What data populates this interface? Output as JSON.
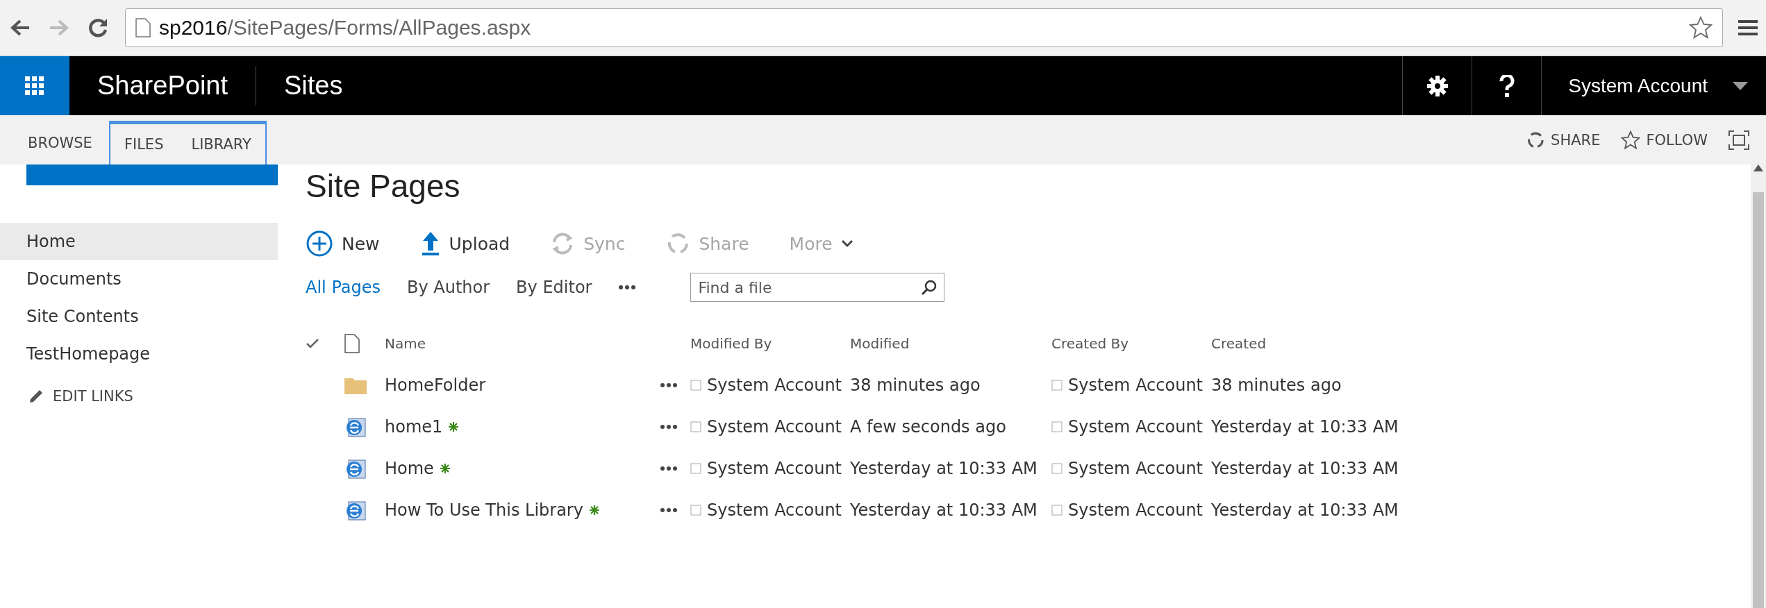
{
  "browser": {
    "url_host": "sp2016",
    "url_path": "/SitePages/Forms/AllPages.aspx"
  },
  "suite_bar": {
    "brand": "SharePoint",
    "title": "Sites",
    "user": "System Account"
  },
  "ribbon": {
    "tabs": [
      {
        "label": "BROWSE",
        "contextual": false
      },
      {
        "label": "FILES",
        "contextual": true
      },
      {
        "label": "LIBRARY",
        "contextual": true
      }
    ],
    "actions": [
      {
        "kind": "share",
        "label": "SHARE"
      },
      {
        "kind": "follow",
        "label": "FOLLOW"
      }
    ]
  },
  "page_title": "Site Pages",
  "nav": {
    "items": [
      {
        "label": "Home",
        "selected": true
      },
      {
        "label": "Documents",
        "selected": false
      },
      {
        "label": "Site Contents",
        "selected": false
      },
      {
        "label": "TestHomepage",
        "selected": false
      }
    ],
    "edit_links": "EDIT LINKS"
  },
  "commands": [
    {
      "kind": "new",
      "label": "New",
      "disabled": false
    },
    {
      "kind": "upload",
      "label": "Upload",
      "disabled": false
    },
    {
      "kind": "sync",
      "label": "Sync",
      "disabled": true
    },
    {
      "kind": "share",
      "label": "Share",
      "disabled": true
    },
    {
      "kind": "more",
      "label": "More",
      "disabled": true
    }
  ],
  "views": [
    {
      "label": "All Pages",
      "selected": true
    },
    {
      "label": "By Author",
      "selected": false
    },
    {
      "label": "By Editor",
      "selected": false
    }
  ],
  "search": {
    "placeholder": "Find a file"
  },
  "table": {
    "columns": [
      "Name",
      "Modified By",
      "Modified",
      "Created By",
      "Created"
    ],
    "rows": [
      {
        "kind": "folder",
        "name": "HomeFolder",
        "new": false,
        "modified_by": "System Account",
        "modified": "38 minutes ago",
        "created_by": "System Account",
        "created": "38 minutes ago"
      },
      {
        "kind": "page",
        "name": "home1",
        "new": true,
        "modified_by": "System Account",
        "modified": "A few seconds ago",
        "created_by": "System Account",
        "created": "Yesterday at 10:33 AM"
      },
      {
        "kind": "page",
        "name": "Home",
        "new": true,
        "modified_by": "System Account",
        "modified": "Yesterday at 10:33 AM",
        "created_by": "System Account",
        "created": "Yesterday at 10:33 AM"
      },
      {
        "kind": "page",
        "name": "How To Use This Library",
        "new": true,
        "modified_by": "System Account",
        "modified": "Yesterday at 10:33 AM",
        "created_by": "System Account",
        "created": "Yesterday at 10:33 AM"
      }
    ]
  }
}
